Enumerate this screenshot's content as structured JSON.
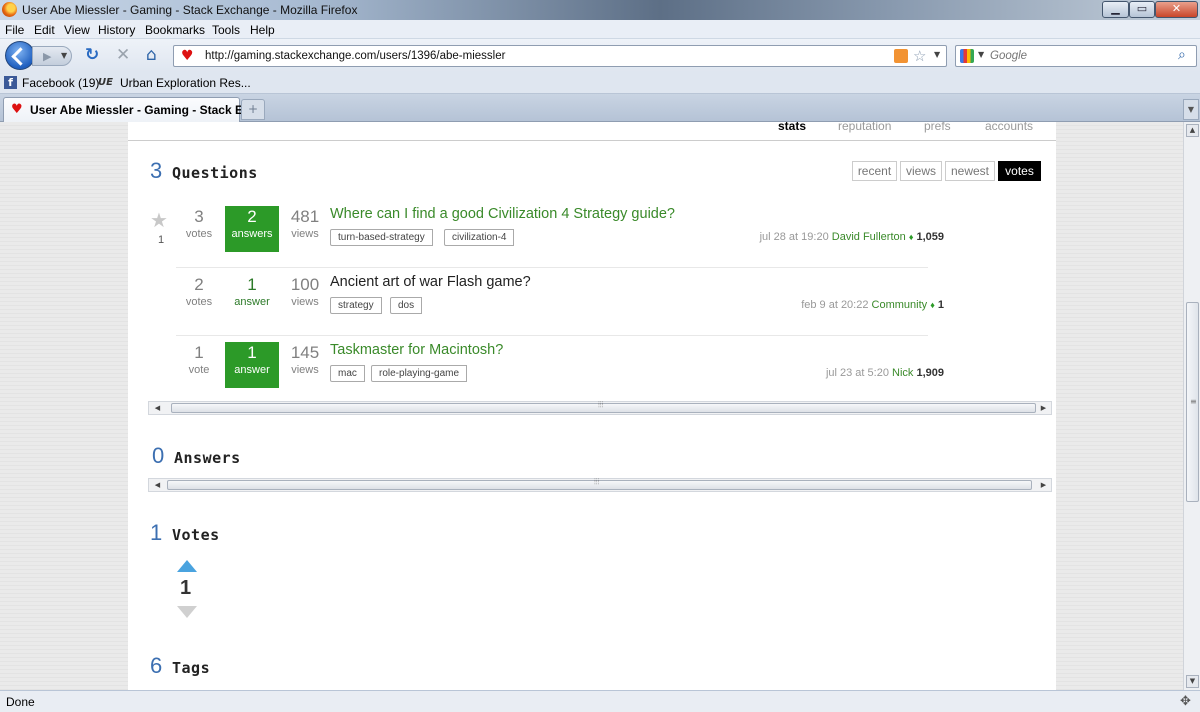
{
  "window": {
    "title": "User Abe Miessler - Gaming - Stack Exchange - Mozilla Firefox",
    "min_glyph": "▁",
    "max_glyph": "▭",
    "close_glyph": "✕"
  },
  "menu": {
    "file": "File",
    "edit": "Edit",
    "view": "View",
    "history": "History",
    "bookmarks": "Bookmarks",
    "tools": "Tools",
    "help": "Help"
  },
  "navbar": {
    "url": "http://gaming.stackexchange.com/users/1396/abe-miessler",
    "search_placeholder": "Google"
  },
  "bookmarks": {
    "facebook": "Facebook (19)",
    "urban": "Urban Exploration Res..."
  },
  "tab": {
    "label": "User Abe Miessler - Gaming - Stack E...",
    "new_tab_glyph": "+"
  },
  "profile_tabs": {
    "stats": "stats",
    "reputation": "reputation",
    "prefs": "prefs",
    "accounts": "accounts"
  },
  "questions": {
    "count": "3",
    "title": "Questions",
    "sort": {
      "recent": "recent",
      "views": "views",
      "newest": "newest",
      "votes": "votes"
    },
    "items": [
      {
        "favorite_count": "1",
        "votes": "3",
        "votes_label": "votes",
        "answers": "2",
        "answers_label": "answers",
        "views": "481",
        "views_label": "views",
        "title": "Where can I find a good Civilization 4 Strategy guide?",
        "tags": [
          "turn-based-strategy",
          "civilization-4"
        ],
        "date": "jul 28 at 19:20",
        "user": "David Fullerton",
        "rep": "1,059"
      },
      {
        "votes": "2",
        "votes_label": "votes",
        "answers": "1",
        "answers_label": "answer",
        "views": "100",
        "views_label": "views",
        "title": "Ancient art of war Flash game?",
        "tags": [
          "strategy",
          "dos"
        ],
        "date": "feb 9 at 20:22",
        "user": "Community",
        "rep": "1"
      },
      {
        "votes": "1",
        "votes_label": "vote",
        "answers": "1",
        "answers_label": "answer",
        "views": "145",
        "views_label": "views",
        "title": "Taskmaster for Macintosh?",
        "tags": [
          "mac",
          "role-playing-game"
        ],
        "date": "jul 23 at 5:20",
        "user": "Nick",
        "rep": "1,909"
      }
    ]
  },
  "answers": {
    "count": "0",
    "title": "Answers"
  },
  "votes": {
    "count": "1",
    "title": "Votes",
    "value": "1"
  },
  "tags": {
    "count": "6",
    "title": "Tags"
  },
  "status": {
    "text": "Done"
  },
  "colors": {
    "accepted": "#2c9a28",
    "link": "#3a8a2a",
    "count_blue": "#3c6fb1"
  }
}
